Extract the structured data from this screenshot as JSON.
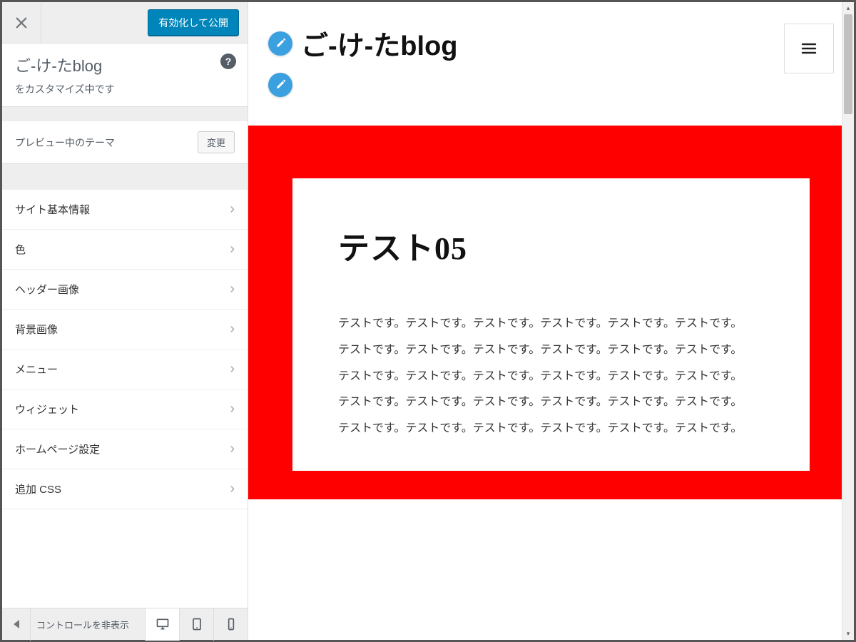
{
  "sidebar": {
    "publish_label": "有効化して公開",
    "site_title": "ご-け-たblog",
    "customizing_text": "をカスタマイズ中です",
    "theme_label": "プレビュー中のテーマ",
    "change_label": "変更",
    "hide_controls_text": "コントロールを非表示",
    "panels": [
      {
        "label": "サイト基本情報"
      },
      {
        "label": "色"
      },
      {
        "label": "ヘッダー画像"
      },
      {
        "label": "背景画像"
      },
      {
        "label": "メニュー"
      },
      {
        "label": "ウィジェット"
      },
      {
        "label": "ホームページ設定"
      },
      {
        "label": "追加 CSS"
      }
    ]
  },
  "preview": {
    "blog_title": "ご-け-たblog",
    "post_title": "テスト05",
    "paragraph_line": "テストです。テストです。テストです。テストです。テストです。テストです。"
  },
  "colors": {
    "accent_bg": "#ff0000",
    "publish_bg": "#0085ba",
    "edit_bubble": "#3ba0e0"
  }
}
